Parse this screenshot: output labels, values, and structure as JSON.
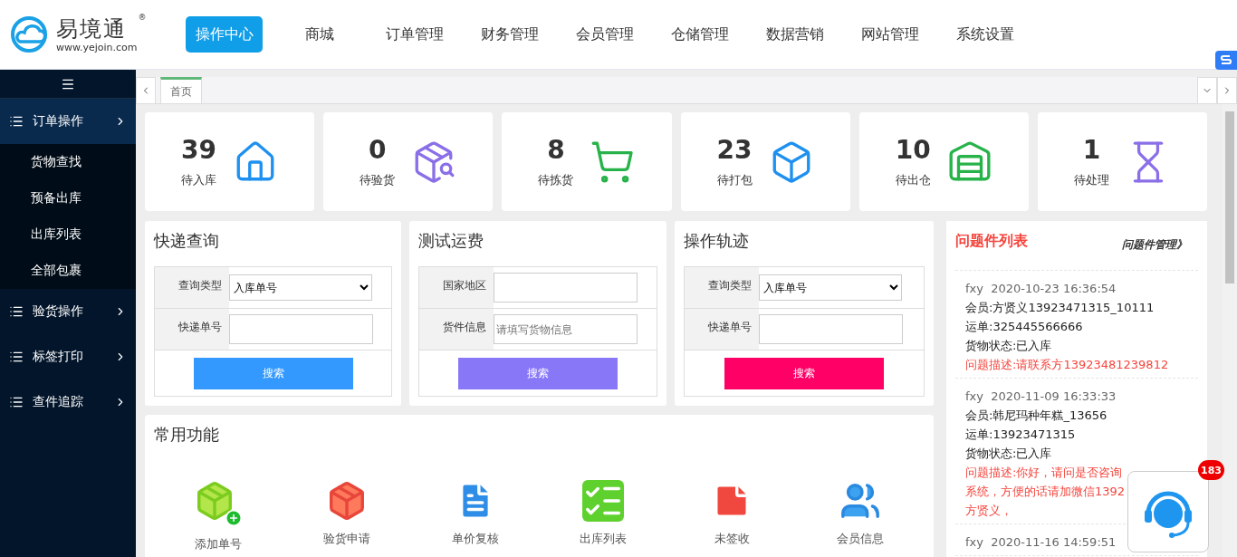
{
  "header": {
    "logo": {
      "name": "易境通",
      "mark": "®",
      "url": "www.yejoin.com"
    },
    "nav": [
      {
        "label": "操作中心",
        "selected": true
      },
      {
        "label": "商城",
        "selected": false
      },
      {
        "label": "订单管理",
        "selected": false
      },
      {
        "label": "财务管理",
        "selected": false
      },
      {
        "label": "会员管理",
        "selected": false
      },
      {
        "label": "仓储管理",
        "selected": false
      },
      {
        "label": "数据营销",
        "selected": false
      },
      {
        "label": "网站管理",
        "selected": false
      },
      {
        "label": "系统设置",
        "selected": false
      }
    ]
  },
  "sidebar": {
    "items": [
      {
        "label": "订单操作",
        "expanded": true,
        "children": [
          {
            "label": "货物查找"
          },
          {
            "label": "预备出库"
          },
          {
            "label": "出库列表"
          },
          {
            "label": "全部包裹"
          }
        ]
      },
      {
        "label": "验货操作",
        "expanded": false
      },
      {
        "label": "标签打印",
        "expanded": false
      },
      {
        "label": "查件追踪",
        "expanded": false
      }
    ]
  },
  "tabs": [
    {
      "label": "首页",
      "selected": true
    }
  ],
  "stats": [
    {
      "value": "39",
      "label": "待入库",
      "kind": "inbound"
    },
    {
      "value": "0",
      "label": "待验货",
      "kind": "inspect"
    },
    {
      "value": "8",
      "label": "待拣货",
      "kind": "pick"
    },
    {
      "value": "23",
      "label": "待打包",
      "kind": "pack"
    },
    {
      "value": "10",
      "label": "待出仓",
      "kind": "outbound"
    },
    {
      "value": "1",
      "label": "待处理",
      "kind": "pending"
    }
  ],
  "forms": [
    {
      "title": "快递查询",
      "rows": [
        {
          "kind": "select",
          "label": "查询类型",
          "value": "入库单号"
        },
        {
          "kind": "input",
          "label": "快递单号"
        }
      ],
      "button": {
        "label": "搜索",
        "color": "#3399ff"
      }
    },
    {
      "title": "测试运费",
      "rows": [
        {
          "kind": "input",
          "label": "国家地区"
        },
        {
          "kind": "input",
          "label": "货件信息",
          "placeholder": "请填写货物信息"
        }
      ],
      "button": {
        "label": "搜索",
        "color": "#8878f8"
      }
    },
    {
      "title": "操作轨迹",
      "rows": [
        {
          "kind": "select",
          "label": "查询类型",
          "value": "入库单号"
        },
        {
          "kind": "input",
          "label": "快递单号"
        }
      ],
      "button": {
        "label": "搜索",
        "color": "#ff0066"
      }
    }
  ],
  "functions": {
    "title": "常用功能",
    "items": [
      {
        "label": "添加单号",
        "kind": "add"
      },
      {
        "label": "验货申请",
        "kind": "inspect"
      },
      {
        "label": "单价复核",
        "kind": "review"
      },
      {
        "label": "出库列表",
        "kind": "list"
      },
      {
        "label": "未签收",
        "kind": "note"
      },
      {
        "label": "会员信息",
        "kind": "members"
      }
    ]
  },
  "issues": {
    "title": "问题件列表",
    "link": "问题件管理》",
    "items": [
      {
        "user": "fxy",
        "time": "2020-10-23 16:36:54",
        "lines": [
          "会员:方贤义13923471315_10111",
          "运单:325445566666",
          "货物状态:已入库"
        ],
        "description": [
          "问题描述:请联系方13923481239812"
        ]
      },
      {
        "user": "fxy",
        "time": "2020-11-09 16:33:33",
        "lines": [
          "会员:韩尼玛种年糕_13656",
          "运单:13923471315",
          "货物状态:已入库"
        ],
        "description": [
          "问题描述:你好，请问是否咨询",
          "系统，方便的话请加微信1392",
          "方贤义，"
        ]
      },
      {
        "user": "fxy",
        "time": "2020-11-16 14:59:51"
      }
    ]
  },
  "chat": {
    "badge": "183"
  }
}
